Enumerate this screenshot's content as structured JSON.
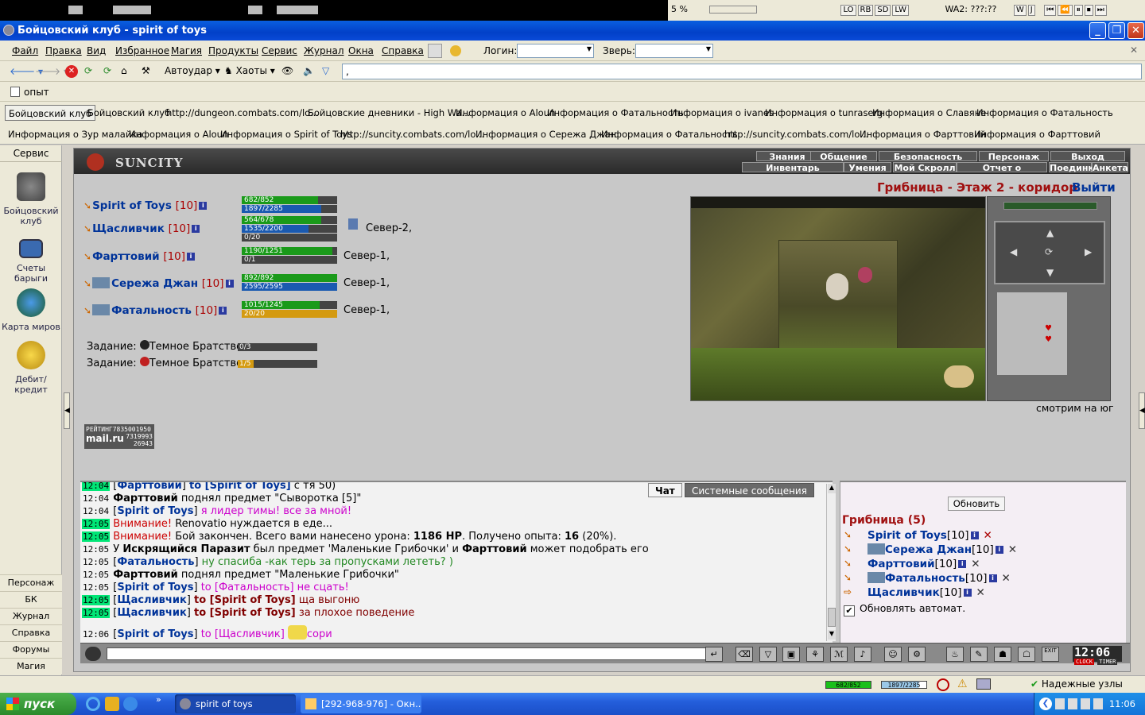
{
  "window": {
    "title": "Бойцовский клуб - spirit of toys"
  },
  "topbar": {
    "wa_label": "WA2:",
    "wa_time": "???:??",
    "pct": "5 %",
    "btns": [
      "LO",
      "RB",
      "SD",
      "LW"
    ],
    "ctrl": [
      "W",
      "J",
      "⏮",
      "⏪",
      "⏸",
      "⏹",
      "⏭"
    ]
  },
  "menu": {
    "items": [
      "Файл",
      "Правка",
      "Вид",
      "Избранное",
      "Магия",
      "Продукты",
      "Сервис",
      "Журнал",
      "Окна",
      "Справка"
    ],
    "login_label": "Логин:",
    "beast_label": "Зверь:"
  },
  "toolbar": {
    "autoudar": "Автоудар",
    "haoty": "Хаоты",
    "address": ","
  },
  "bar3": {
    "label": "опыт"
  },
  "tabs_row1": [
    "Бойцовский клуб",
    "Бойцовский клуб",
    "http://dungeon.combats.com/lo...",
    "Бойцовские дневники - High Wa...",
    "Информация о Aloun",
    "Информация о Фатальность",
    "Информация о ivanes",
    "Информация о tunraserg",
    "Информация о Славяне",
    "Информация о Фатальность"
  ],
  "tabs_row2": [
    "Информация о Зур малайка",
    "Информация о Aloun",
    "Информация о Spirit of Toys",
    "http://suncity.combats.com/lo...",
    "Информация о Сережа Джан",
    "Информация о Фатальность",
    "http://suncity.combats.com/lo...",
    "Информация о Фарттовий",
    "Информация о Фарттовий"
  ],
  "sidebar": {
    "header": "Сервис",
    "items": [
      {
        "label": "Бойцовский клуб",
        "icon": "fight-club-icon"
      },
      {
        "label": "Счеты барыги",
        "icon": "calculator-icon"
      },
      {
        "label": "Карта миров",
        "icon": "globe-icon"
      },
      {
        "label": "Дебит/кредит",
        "icon": "coins-icon"
      }
    ],
    "bottom": [
      "Персонаж",
      "БК",
      "Журнал",
      "Справка",
      "Форумы",
      "Магия"
    ]
  },
  "game": {
    "brand": "SUNCITY",
    "nav_top": [
      "Знания",
      "Общение",
      "Безопасность",
      "Персонаж",
      "Выход"
    ],
    "nav_bottom": [
      "Инвентарь",
      "Умения",
      "Мой Скролл",
      "Отчет о переводах",
      "Поединки",
      "Анкета"
    ],
    "room_title": "Грибница - Этаж 2 - коридор",
    "exit": "Выйти",
    "look_dir": "смотрим на юг",
    "players": [
      {
        "name": "Spirit of Toys",
        "level": "[10]",
        "hp": "682/852",
        "hp_pct": 0.8,
        "mp": "1897/2285",
        "mp_pct": 0.83,
        "extra": null,
        "loc": ""
      },
      {
        "name": "Щасливчик",
        "level": "[10]",
        "hp": "564/678",
        "hp_pct": 0.83,
        "mp": "1535/2200",
        "mp_pct": 0.7,
        "extra": "0/20",
        "extra_pct": 0,
        "loc": "Север-2,"
      },
      {
        "name": "Фарттовий",
        "level": "[10]",
        "hp": "1190/1251",
        "hp_pct": 0.95,
        "mp": null,
        "extra": "0/1",
        "extra_pct": 0,
        "loc": "Север-1,"
      },
      {
        "name": "Сережа Джан",
        "level": "[10]",
        "hp": "892/892",
        "hp_pct": 1,
        "mp": "2595/2595",
        "mp_pct": 1,
        "extra": null,
        "loc": "Север-1,"
      },
      {
        "name": "Фатальность",
        "level": "[10]",
        "hp": "1015/1245",
        "hp_pct": 0.82,
        "mp": null,
        "extra": "20/20",
        "extra_pct": 1,
        "loc": "Север-1,"
      }
    ],
    "tasks": [
      {
        "label": "Задание:",
        "name": "Темное Братство",
        "progress": "0/3"
      },
      {
        "label": "Задание:",
        "name": "Темное Братство",
        "progress": "1/5"
      }
    ],
    "counter": {
      "l1": "РЕЙТИНГ7835001950",
      "l2": "mail.ru",
      "l3": "7319993",
      "l4": "26943"
    }
  },
  "chat": {
    "tabs": [
      "Чат",
      "Системные сообщения"
    ],
    "lines": [
      {
        "time": "12:04",
        "g": true,
        "parts": [
          [
            "[",
            "n"
          ],
          [
            "Фарттовий",
            "nm"
          ],
          [
            "] ",
            "n"
          ],
          [
            "to [Spirit of Toys]",
            "nb"
          ],
          [
            " с тя 50)",
            "n"
          ]
        ]
      },
      {
        "time": "12:04",
        "g": false,
        "parts": [
          [
            "Фарттовий",
            "b"
          ],
          [
            " поднял предмет \"Сыворотка [5]\"",
            "n"
          ]
        ]
      },
      {
        "time": "12:04",
        "g": false,
        "parts": [
          [
            "[",
            "n"
          ],
          [
            "Spirit of Toys",
            "nm"
          ],
          [
            "] ",
            "n"
          ],
          [
            "я лидер тимы! все за мной!",
            "pk"
          ]
        ]
      },
      {
        "time": "12:05",
        "g": true,
        "parts": [
          [
            "Внимание!",
            "rd"
          ],
          [
            " Renovatio нуждается в еде...",
            "n"
          ]
        ]
      },
      {
        "time": "12:05",
        "g": true,
        "parts": [
          [
            "Внимание!",
            "rd"
          ],
          [
            " Бой закончен. Всего вами нанесено урона: ",
            "n"
          ],
          [
            "1186 HP",
            "b"
          ],
          [
            ". Получено опыта: ",
            "n"
          ],
          [
            "16",
            "b"
          ],
          [
            " (20%).",
            "n"
          ]
        ]
      },
      {
        "time": "12:05",
        "g": false,
        "parts": [
          [
            "У ",
            "n"
          ],
          [
            "Искрящийся Паразит",
            "b"
          ],
          [
            " был предмет 'Маленькие Грибочки' и ",
            "n"
          ],
          [
            "Фарттовий",
            "b"
          ],
          [
            " может подобрать его",
            "n"
          ]
        ]
      },
      {
        "time": "12:05",
        "g": false,
        "parts": [
          [
            "[",
            "n"
          ],
          [
            "Фатальность",
            "nm"
          ],
          [
            "] ",
            "n"
          ],
          [
            "ну спасиба -как терь за пропусками лететь? )",
            "gr"
          ]
        ]
      },
      {
        "time": "12:05",
        "g": false,
        "parts": [
          [
            "Фарттовий",
            "b"
          ],
          [
            " поднял предмет \"Маленькие Грибочки\"",
            "n"
          ]
        ]
      },
      {
        "time": "12:05",
        "g": false,
        "parts": [
          [
            "[",
            "n"
          ],
          [
            "Spirit of Toys",
            "nm"
          ],
          [
            "] ",
            "n"
          ],
          [
            "to [Фатальность] не сцать!",
            "pk"
          ]
        ]
      },
      {
        "time": "12:05",
        "g": true,
        "parts": [
          [
            "[",
            "n"
          ],
          [
            "Щасливчик",
            "nm"
          ],
          [
            "] ",
            "n"
          ],
          [
            "to [Spirit of Toys]",
            "br-b"
          ],
          [
            " ща выгоню",
            "br"
          ]
        ]
      },
      {
        "time": "12:05",
        "g": true,
        "parts": [
          [
            "[",
            "n"
          ],
          [
            "Щасливчик",
            "nm"
          ],
          [
            "] ",
            "n"
          ],
          [
            "to [Spirit of Toys]",
            "br-b"
          ],
          [
            " за плохое поведение",
            "br"
          ]
        ]
      },
      {
        "time": "12:06",
        "g": false,
        "parts": [
          [
            "[",
            "n"
          ],
          [
            "Spirit of Toys",
            "nm"
          ],
          [
            "] ",
            "n"
          ],
          [
            "to [Щасливчик]",
            "pk"
          ],
          [
            "      ",
            "n"
          ],
          [
            "сори",
            "pk"
          ]
        ]
      }
    ]
  },
  "online": {
    "refresh": "Обновить",
    "title": "Грибница (5)",
    "players": [
      {
        "name": "Spirit of Toys",
        "level": "[10]"
      },
      {
        "name": "Сережа Джан",
        "level": "[10]"
      },
      {
        "name": "Фарттовий",
        "level": "[10]"
      },
      {
        "name": "Фатальность",
        "level": "[10]"
      },
      {
        "name": "Щасливчик",
        "level": "[10]"
      }
    ],
    "auto": "Обновлять автомат."
  },
  "inputbar": {
    "clock": "12:06",
    "clock_sub": "CLOCK",
    "timer": "TIMER",
    "exit": "EXIT"
  },
  "status": {
    "hp": "682/852",
    "mp": "1897/2285",
    "hp_pct": 0.8,
    "mp_pct": 0.83,
    "reliable": "Надежные узлы"
  },
  "taskbar": {
    "start": "пуск",
    "items": [
      "spirit of toys",
      "[292-968-976] - Окн..."
    ],
    "time": "11:06"
  }
}
